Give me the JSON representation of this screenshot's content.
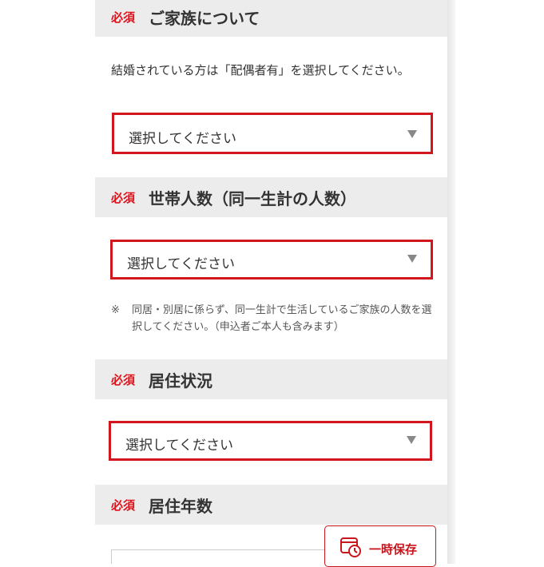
{
  "required_badge": "必須",
  "sections": [
    {
      "title": "ご家族について",
      "description": "結婚されている方は「配偶者有」を選択してください。",
      "select_value": "選択してください"
    },
    {
      "title": "世帯人数（同一生計の人数）",
      "select_value": "選択してください",
      "note_mark": "※",
      "note": "同居・別居に係らず、同一生計で生活しているご家族の人数を選択してください。（申込者ご本人も含みます）"
    },
    {
      "title": "居住状況",
      "select_value": "選択してください"
    },
    {
      "title": "居住年数"
    }
  ],
  "save_button": {
    "label": "一時保存",
    "icon": "clock-save-icon"
  },
  "colors": {
    "required": "#e0111b",
    "highlight_border": "#d2161e",
    "header_bg": "#ececec"
  }
}
